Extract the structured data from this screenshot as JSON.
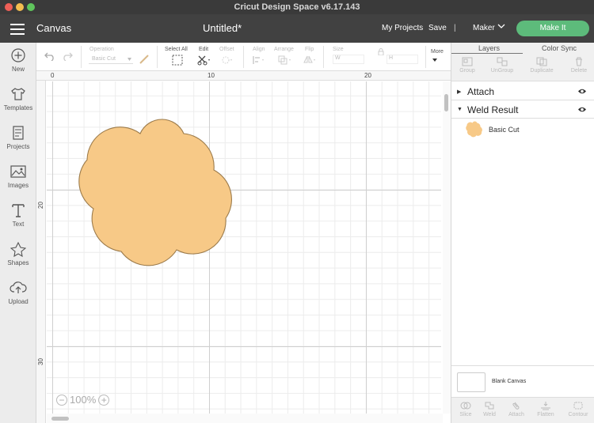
{
  "window": {
    "title": "Cricut Design Space  v6.17.143"
  },
  "header": {
    "canvas_label": "Canvas",
    "document_title": "Untitled*",
    "my_projects": "My Projects",
    "save": "Save",
    "separator": "|",
    "machine": "Maker",
    "make_it": "Make It"
  },
  "left_sidebar": {
    "items": [
      {
        "label": "New",
        "icon": "plus-circle-icon"
      },
      {
        "label": "Templates",
        "icon": "tshirt-icon"
      },
      {
        "label": "Projects",
        "icon": "projects-grid-icon"
      },
      {
        "label": "Images",
        "icon": "image-icon"
      },
      {
        "label": "Text",
        "icon": "text-t-icon"
      },
      {
        "label": "Shapes",
        "icon": "shapes-icon"
      },
      {
        "label": "Upload",
        "icon": "cloud-upload-icon"
      }
    ]
  },
  "toolbar": {
    "operation_label": "Operation",
    "operation_value": "Basic Cut",
    "select_all": "Select All",
    "edit": "Edit",
    "offset": "Offset",
    "align": "Align",
    "arrange": "Arrange",
    "flip": "Flip",
    "size": "Size",
    "width_prefix": "W",
    "height_prefix": "H",
    "more": "More"
  },
  "rulers": {
    "top": [
      "0",
      "10",
      "20"
    ],
    "left": [
      "20",
      "30"
    ]
  },
  "canvas": {
    "zoom": "100%",
    "shape_fill": "#f7c987",
    "shape_stroke": "#9c7b4b"
  },
  "right_panel": {
    "tabs": [
      "Layers",
      "Color Sync"
    ],
    "actions": [
      "Group",
      "UnGroup",
      "Duplicate",
      "Delete"
    ],
    "layers": [
      {
        "name": "Attach"
      },
      {
        "name": "Weld Result"
      }
    ],
    "sub_layer": {
      "name": "Basic Cut",
      "color": "#f7c987"
    },
    "blank_canvas": "Blank Canvas",
    "bottom_actions": [
      "Slice",
      "Weld",
      "Attach",
      "Flatten",
      "Contour"
    ]
  },
  "colors": {
    "header_bg": "#414141",
    "accent": "#5dbb7b"
  }
}
